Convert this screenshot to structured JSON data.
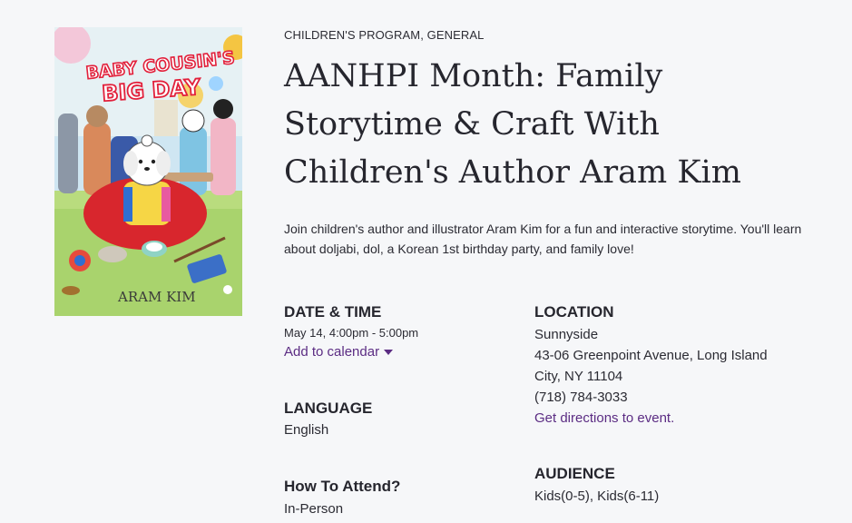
{
  "cover": {
    "title_line1": "BABY COUSIN'S",
    "title_line2": "BIG DAY",
    "author": "ARAM KIM",
    "colors": {
      "background": "#cfe6f2",
      "grass": "#a9d36d",
      "hanbok_red": "#d8262d",
      "title_red": "#e2203b",
      "title_fill": "#ffffff"
    }
  },
  "event": {
    "category": "CHILDREN'S PROGRAM, GENERAL",
    "title": "AANHPI Month: Family Storytime & Craft With Children's Author Aram Kim",
    "description": "Join children's author and illustrator Aram Kim for a fun and interactive storytime. You'll learn about doljabi, dol, a Korean 1st birthday party, and family love!"
  },
  "date_time": {
    "label": "DATE & TIME",
    "value": "May 14, 4:00pm - 5:00pm",
    "calendar_link": "Add to calendar"
  },
  "language": {
    "label": "LANGUAGE",
    "value": "English"
  },
  "attend": {
    "label": "How To Attend?",
    "value": "In-Person"
  },
  "location": {
    "label": "LOCATION",
    "branch": "Sunnyside",
    "address_line1": "43-06 Greenpoint Avenue, Long Island",
    "address_line2": "City, NY 11104",
    "phone": "(718) 784-3033",
    "directions_link": "Get directions to event."
  },
  "audience": {
    "label": "AUDIENCE",
    "value": "Kids(0-5), Kids(6-11)"
  },
  "colors": {
    "link": "#5b2c83",
    "text": "#2b2b33",
    "background": "#f6f7f9"
  }
}
